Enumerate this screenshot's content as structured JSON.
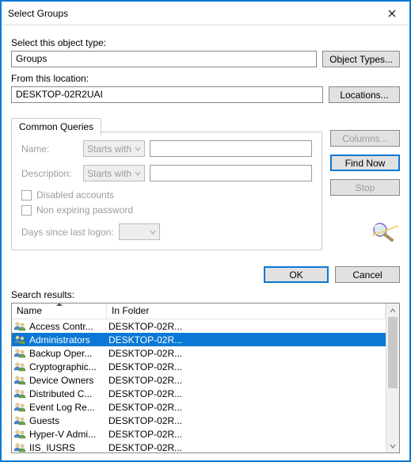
{
  "title": "Select Groups",
  "objectType": {
    "label": "Select this object type:",
    "value": "Groups",
    "button": "Object Types..."
  },
  "location": {
    "label": "From this location:",
    "value": "DESKTOP-02R2UAI",
    "button": "Locations..."
  },
  "tab": {
    "label": "Common Queries"
  },
  "query": {
    "nameLabel": "Name:",
    "nameMode": "Starts with",
    "descLabel": "Description:",
    "descMode": "Starts with",
    "disabledAccounts": "Disabled accounts",
    "nonExpiring": "Non expiring password",
    "daysLabel": "Days since last logon:"
  },
  "side": {
    "columns": "Columns...",
    "findNow": "Find Now",
    "stop": "Stop"
  },
  "buttons": {
    "ok": "OK",
    "cancel": "Cancel"
  },
  "results": {
    "label": "Search results:",
    "columns": {
      "name": "Name",
      "folder": "In Folder"
    },
    "rows": [
      {
        "name": "Access Contr...",
        "folder": "DESKTOP-02R...",
        "selected": false
      },
      {
        "name": "Administrators",
        "folder": "DESKTOP-02R...",
        "selected": true
      },
      {
        "name": "Backup Oper...",
        "folder": "DESKTOP-02R...",
        "selected": false
      },
      {
        "name": "Cryptographic...",
        "folder": "DESKTOP-02R...",
        "selected": false
      },
      {
        "name": "Device Owners",
        "folder": "DESKTOP-02R...",
        "selected": false
      },
      {
        "name": "Distributed C...",
        "folder": "DESKTOP-02R...",
        "selected": false
      },
      {
        "name": "Event Log Re...",
        "folder": "DESKTOP-02R...",
        "selected": false
      },
      {
        "name": "Guests",
        "folder": "DESKTOP-02R...",
        "selected": false
      },
      {
        "name": "Hyper-V Admi...",
        "folder": "DESKTOP-02R...",
        "selected": false
      },
      {
        "name": "IIS_IUSRS",
        "folder": "DESKTOP-02R...",
        "selected": false
      }
    ]
  }
}
